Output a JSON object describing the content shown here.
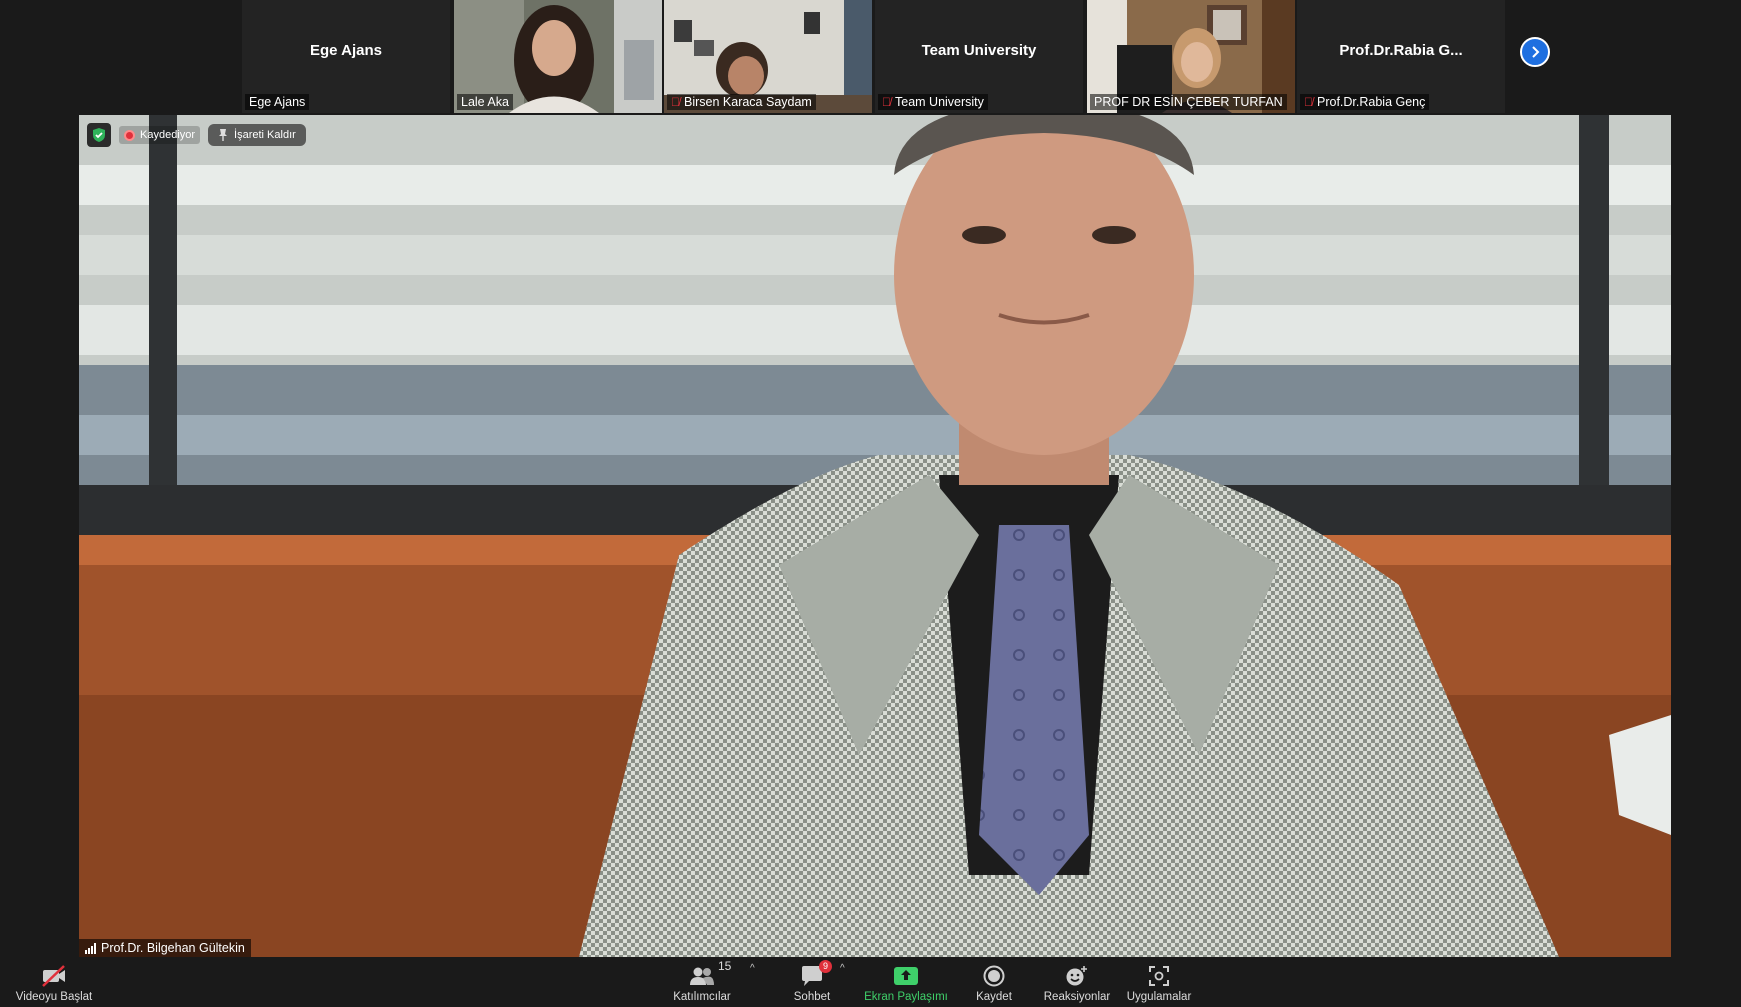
{
  "participants": [
    {
      "label": "Ege Ajans",
      "center_name": "Ege Ajans",
      "muted": false,
      "has_video": false
    },
    {
      "label": "Lale Aka",
      "center_name": "",
      "muted": false,
      "has_video": true
    },
    {
      "label": "Birsen Karaca Saydam",
      "center_name": "",
      "muted": true,
      "has_video": true
    },
    {
      "label": "Team University",
      "center_name": "Team University",
      "muted": true,
      "has_video": false
    },
    {
      "label": "PROF DR ESİN ÇEBER TURFAN",
      "center_name": "",
      "muted": false,
      "has_video": true
    },
    {
      "label": "Prof.Dr.Rabia Genç",
      "center_name": "Prof.Dr.Rabia  G...",
      "muted": true,
      "has_video": false
    }
  ],
  "main": {
    "recording_label": "Kaydediyor",
    "unpin_label": "İşareti Kaldır",
    "speaker_name": "Prof.Dr. Bilgehan Gültekin"
  },
  "toolbar": {
    "video_label": "Videoyu Başlat",
    "participants_label": "Katılımcılar",
    "participants_count": "15",
    "chat_label": "Sohbet",
    "chat_badge": "9",
    "share_label": "Ekran Paylaşımı",
    "record_label": "Kaydet",
    "reactions_label": "Reaksiyonlar",
    "apps_label": "Uygulamalar"
  },
  "colors": {
    "background": "#1a1a1a",
    "tile": "#232323",
    "accent_blue": "#1e6fe0",
    "share_green": "#3fd06a",
    "mute_red": "#e0303b"
  }
}
